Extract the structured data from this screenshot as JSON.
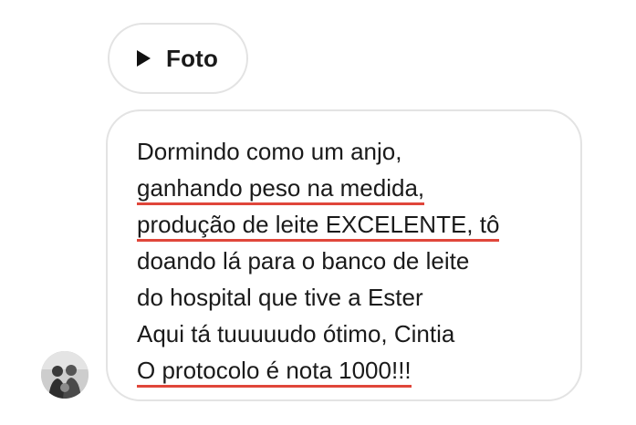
{
  "photo": {
    "label": "Foto",
    "icon": "play-icon"
  },
  "message": {
    "lines": [
      {
        "text": "Dormindo como um anjo,",
        "underlined": false
      },
      {
        "text": "ganhando peso na medida,",
        "underlined": true
      },
      {
        "text": "produção de leite EXCELENTE, tô",
        "underlined": true
      },
      {
        "text": "doando lá para o banco de leite",
        "underlined": false
      },
      {
        "text": "do hospital que tive a Ester",
        "underlined": false
      },
      {
        "text": "Aqui tá tuuuuudo ótimo, Cintia",
        "underlined": false
      },
      {
        "text": "O protocolo é nota 1000!!!",
        "underlined": true
      }
    ]
  },
  "colors": {
    "underline": "#e0463a",
    "bubble_border": "#e3e3e3",
    "text": "#1a1a1a"
  }
}
